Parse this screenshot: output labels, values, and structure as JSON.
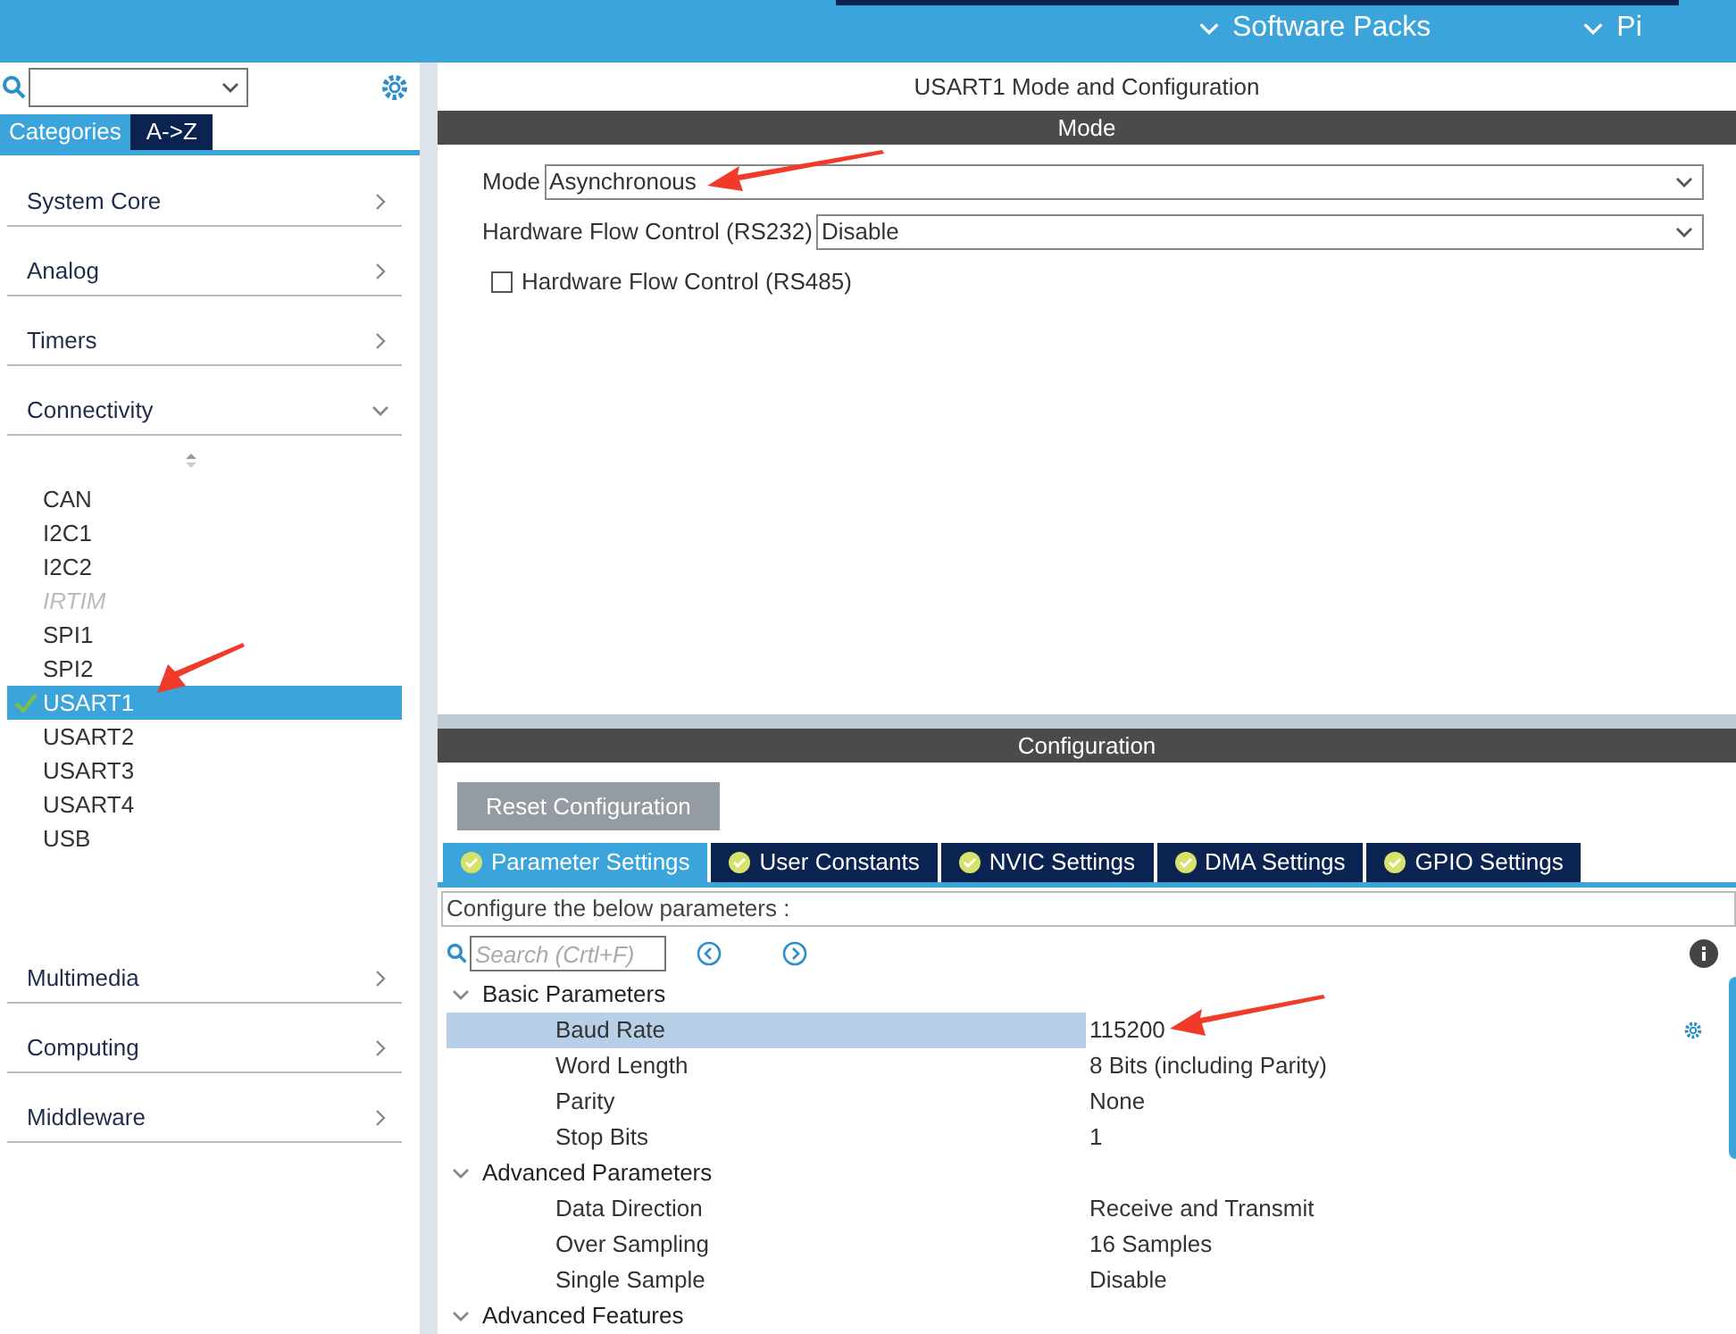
{
  "top_bar": {
    "menus": [
      {
        "label": "Software Packs"
      },
      {
        "label": "Pi"
      }
    ]
  },
  "sidebar": {
    "tabs": [
      {
        "label": "Categories",
        "selected": true
      },
      {
        "label": "A->Z",
        "selected": false
      }
    ],
    "categories": [
      {
        "label": "System Core",
        "expanded": false
      },
      {
        "label": "Analog",
        "expanded": false
      },
      {
        "label": "Timers",
        "expanded": false
      },
      {
        "label": "Connectivity",
        "expanded": true,
        "items": [
          {
            "label": "CAN",
            "selected": false,
            "disabled": false,
            "configured": false
          },
          {
            "label": "I2C1",
            "selected": false,
            "disabled": false,
            "configured": false
          },
          {
            "label": "I2C2",
            "selected": false,
            "disabled": false,
            "configured": false
          },
          {
            "label": "IRTIM",
            "selected": false,
            "disabled": true,
            "configured": false
          },
          {
            "label": "SPI1",
            "selected": false,
            "disabled": false,
            "configured": false
          },
          {
            "label": "SPI2",
            "selected": false,
            "disabled": false,
            "configured": false
          },
          {
            "label": "USART1",
            "selected": true,
            "disabled": false,
            "configured": true
          },
          {
            "label": "USART2",
            "selected": false,
            "disabled": false,
            "configured": false
          },
          {
            "label": "USART3",
            "selected": false,
            "disabled": false,
            "configured": false
          },
          {
            "label": "USART4",
            "selected": false,
            "disabled": false,
            "configured": false
          },
          {
            "label": "USB",
            "selected": false,
            "disabled": false,
            "configured": false
          }
        ]
      },
      {
        "label": "Multimedia",
        "expanded": false
      },
      {
        "label": "Computing",
        "expanded": false
      },
      {
        "label": "Middleware",
        "expanded": false
      }
    ]
  },
  "main": {
    "title": "USART1 Mode and Configuration",
    "mode_section": {
      "header": "Mode",
      "fields": [
        {
          "kind": "select",
          "label": "Mode",
          "value": "Asynchronous"
        },
        {
          "kind": "select",
          "label": "Hardware Flow Control (RS232)",
          "value": "Disable"
        },
        {
          "kind": "checkbox",
          "label": "Hardware Flow Control (RS485)",
          "checked": false
        }
      ]
    },
    "configuration": {
      "header": "Configuration",
      "reset_button": "Reset Configuration",
      "tabs": [
        {
          "label": "Parameter Settings",
          "selected": true
        },
        {
          "label": "User Constants",
          "selected": false
        },
        {
          "label": "NVIC Settings",
          "selected": false
        },
        {
          "label": "DMA Settings",
          "selected": false
        },
        {
          "label": "GPIO Settings",
          "selected": false
        }
      ],
      "hint": "Configure the below parameters :",
      "search": {
        "placeholder": "Search (Crtl+F)"
      },
      "parameters": [
        {
          "label": "Basic Parameters",
          "expanded": true,
          "children": [
            {
              "label": "Baud Rate",
              "value": "115200",
              "selected": true
            },
            {
              "label": "Word Length",
              "value": "8 Bits (including Parity)",
              "selected": false
            },
            {
              "label": "Parity",
              "value": "None",
              "selected": false
            },
            {
              "label": "Stop Bits",
              "value": "1",
              "selected": false
            }
          ]
        },
        {
          "label": "Advanced Parameters",
          "expanded": true,
          "children": [
            {
              "label": "Data Direction",
              "value": "Receive and Transmit",
              "selected": false
            },
            {
              "label": "Over Sampling",
              "value": "16 Samples",
              "selected": false
            },
            {
              "label": "Single Sample",
              "value": "Disable",
              "selected": false
            }
          ]
        },
        {
          "label": "Advanced Features",
          "expanded": true
        }
      ]
    }
  }
}
